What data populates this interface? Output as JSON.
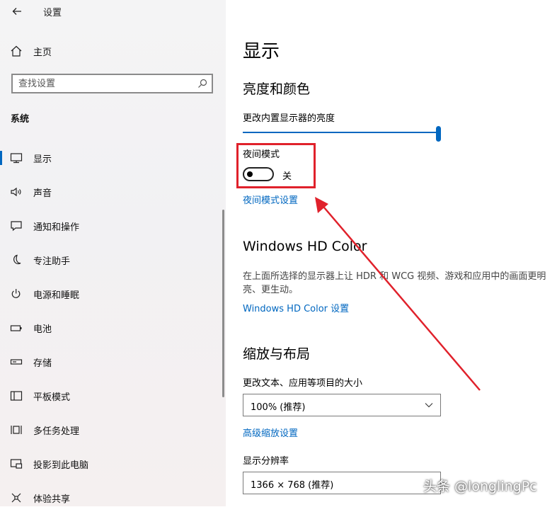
{
  "window": {
    "title": "设置"
  },
  "sidebar": {
    "home_label": "主页",
    "search_placeholder": "查找设置",
    "section_label": "系统",
    "items": [
      {
        "label": "显示",
        "icon": "monitor-icon",
        "selected": true
      },
      {
        "label": "声音",
        "icon": "speaker-icon"
      },
      {
        "label": "通知和操作",
        "icon": "notification-icon"
      },
      {
        "label": "专注助手",
        "icon": "moon-icon"
      },
      {
        "label": "电源和睡眠",
        "icon": "power-icon"
      },
      {
        "label": "电池",
        "icon": "battery-icon"
      },
      {
        "label": "存储",
        "icon": "storage-icon"
      },
      {
        "label": "平板模式",
        "icon": "tablet-icon"
      },
      {
        "label": "多任务处理",
        "icon": "multitask-icon"
      },
      {
        "label": "投影到此电脑",
        "icon": "project-icon"
      },
      {
        "label": "体验共享",
        "icon": "share-icon"
      }
    ]
  },
  "main": {
    "title": "显示",
    "brightness": {
      "heading": "亮度和颜色",
      "label": "更改内置显示器的亮度",
      "level_percent": 100
    },
    "night_light": {
      "label": "夜间模式",
      "state": "关",
      "settings_link": "夜间模式设置"
    },
    "hdr": {
      "heading": "Windows HD Color",
      "description": "在上面所选择的显示器上让 HDR 和 WCG 视频、游戏和应用中的画面更明亮、更生动。",
      "link": "Windows HD Color 设置"
    },
    "scale": {
      "heading": "缩放与布局",
      "label": "更改文本、应用等项目的大小",
      "value": "100% (推荐)",
      "advanced_link": "高级缩放设置"
    },
    "resolution": {
      "label": "显示分辨率",
      "value": "1366 × 768 (推荐)"
    }
  },
  "colors": {
    "accent": "#0067c0",
    "highlight": "#e0212b"
  },
  "watermark": "头条 @longlingPc"
}
